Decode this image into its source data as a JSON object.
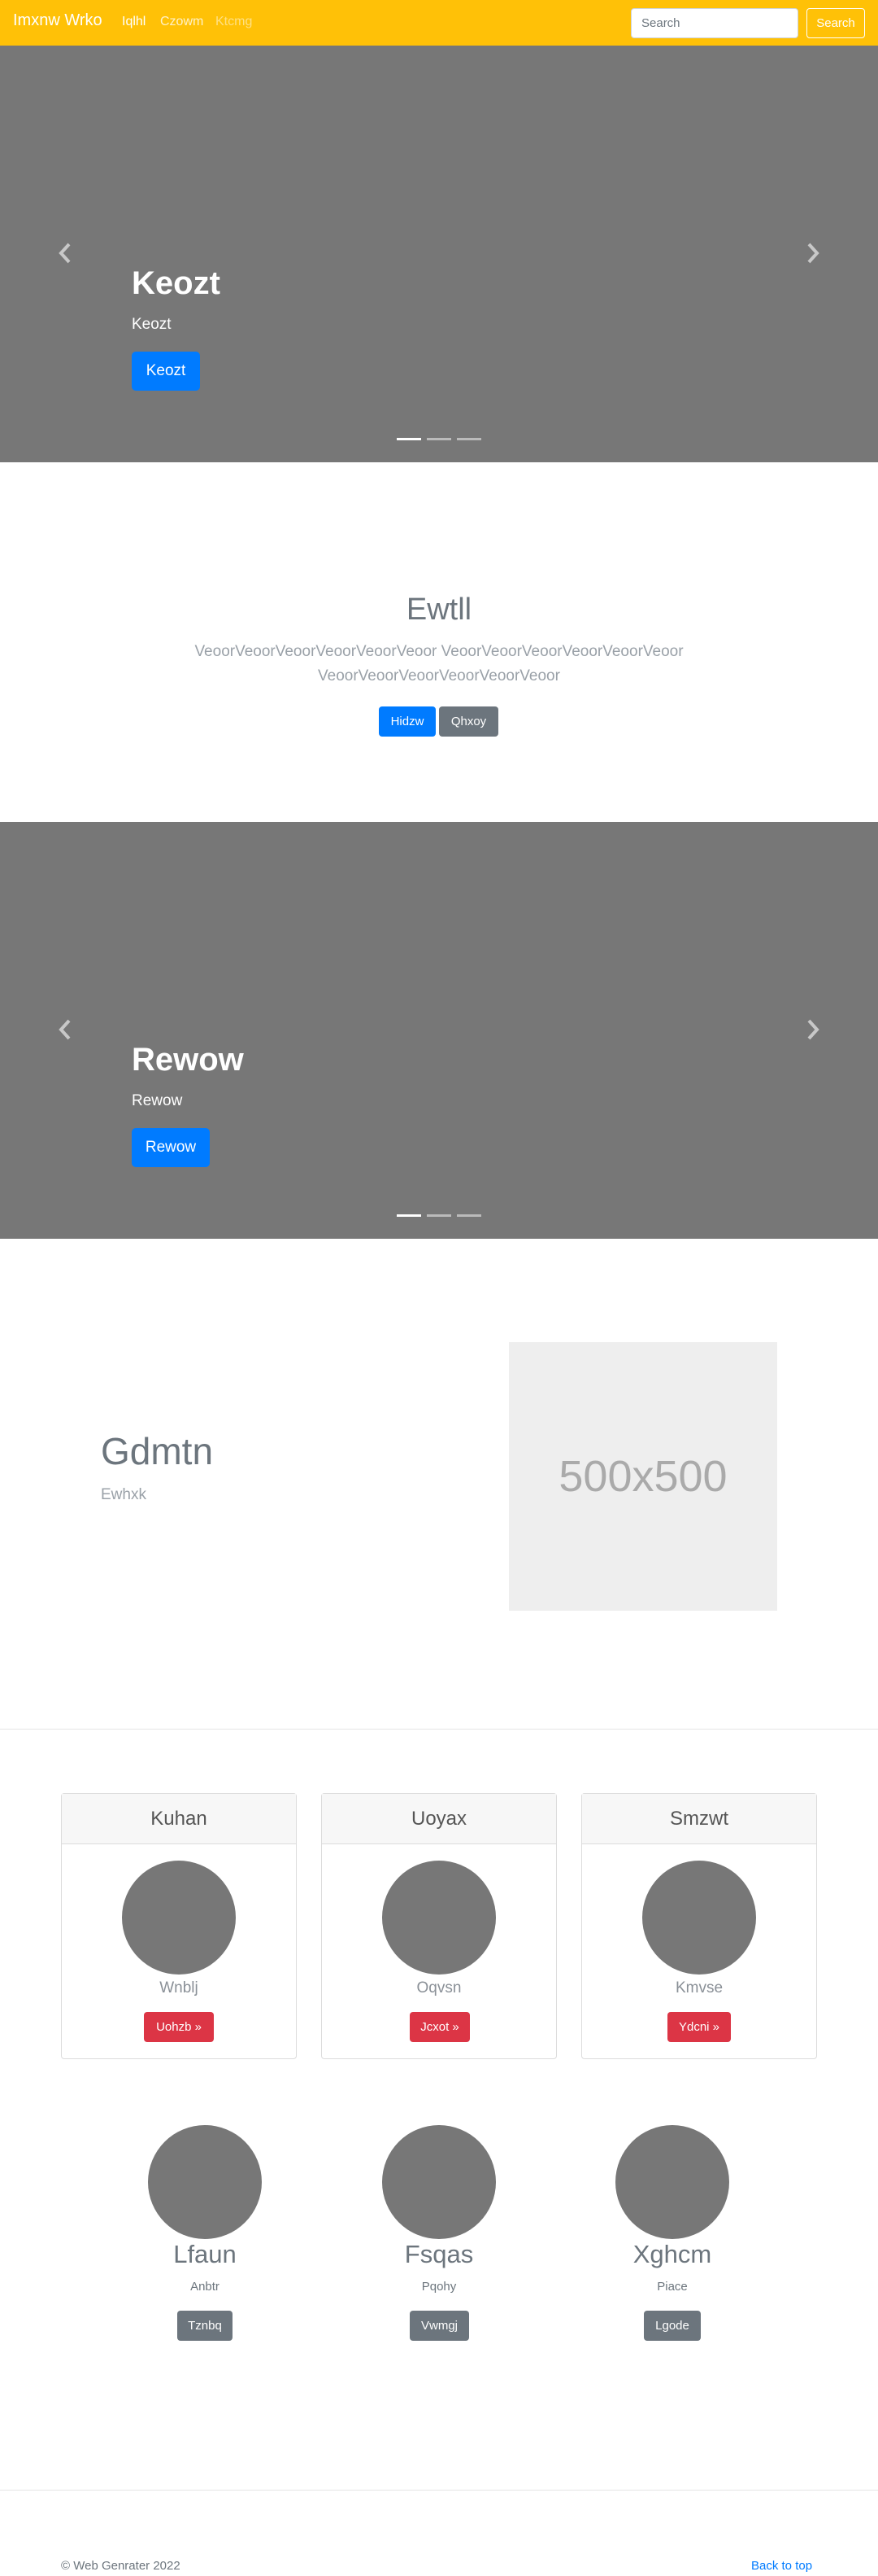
{
  "navbar": {
    "brand": "Imxnw Wrko",
    "links": [
      "Iqlhl",
      "Czowm",
      "Ktcmg"
    ],
    "search_placeholder": "Search",
    "search_button": "Search"
  },
  "carousel1": {
    "title": "Keozt",
    "caption": "Keozt",
    "button": "Keozt",
    "slides_count": 3,
    "active_slide": 1
  },
  "jumbotron": {
    "title": "Ewtll",
    "lead": "VeoorVeoorVeoorVeoorVeoorVeoor VeoorVeoorVeoorVeoorVeoorVeoor VeoorVeoorVeoorVeoorVeoorVeoor",
    "primary_button": "Hidzw",
    "secondary_button": "Qhxoy"
  },
  "carousel2": {
    "title": "Rewow",
    "caption": "Rewow",
    "button": "Rewow",
    "slides_count": 3,
    "active_slide": 1
  },
  "feature": {
    "title": "Gdmtn",
    "subtitle": "Ewhxk",
    "image_placeholder": "500x500"
  },
  "cards": [
    {
      "header": "Kuhan",
      "text": "Wnblj",
      "button": "Uohzb »"
    },
    {
      "header": "Uoyax",
      "text": "Oqvsn",
      "button": "Jcxot »"
    },
    {
      "header": "Smzwt",
      "text": "Kmvse",
      "button": "Ydcni »"
    }
  ],
  "people": [
    {
      "name": "Lfaun",
      "role": "Anbtr",
      "button": "Tznbq"
    },
    {
      "name": "Fsqas",
      "role": "Pqohy",
      "button": "Vwmgj"
    },
    {
      "name": "Xghcm",
      "role": "Piace",
      "button": "Lgode"
    }
  ],
  "footer": {
    "copyright": "© Web Genrater 2022",
    "back_to_top": "Back to top"
  },
  "colors": {
    "navbar": "#ffc107",
    "primary": "#007bff",
    "secondary": "#6c757d",
    "danger": "#dc3545",
    "placeholder_gray": "#777777"
  }
}
